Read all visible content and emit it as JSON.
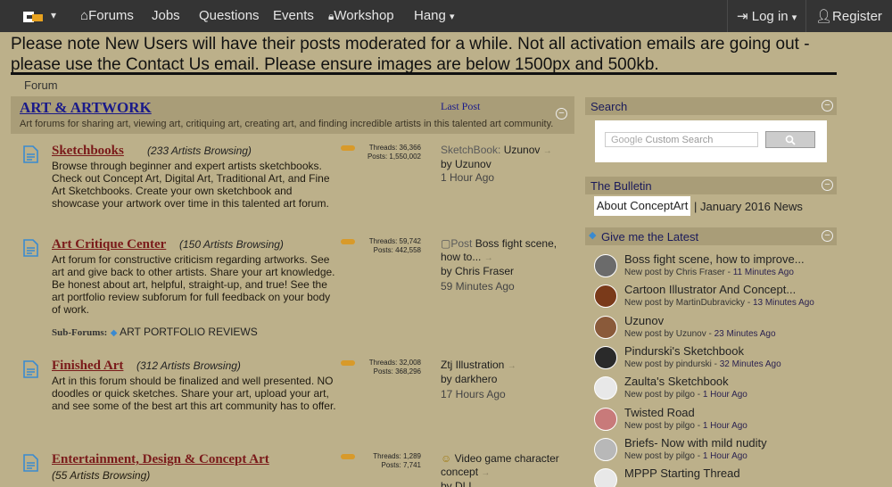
{
  "nav": {
    "items": [
      "Forums",
      "Jobs",
      "Questions",
      "Events",
      "Workshop",
      "Hang"
    ],
    "login": "Log in",
    "register": "Register"
  },
  "notice": "Please note New Users will have their posts moderated for a while. Not all activation emails are going out - please use the Contact Us email. Please ensure images are below 1500px and 500kb.",
  "breadcrumb": "Forum",
  "section": {
    "title": "ART & ARTWORK",
    "last_post_header": "Last Post",
    "description": "Art forums for sharing art, viewing art, critiquing art, creating art, and finding incredible artists in this talented art community."
  },
  "forums": [
    {
      "title": "Sketchbooks",
      "browsing": "(233 Artists Browsing)",
      "description": "Browse through beginner and expert artists sketchbooks. Check out Concept Art, Digital Art, Traditional Art, and Fine Art Sketchbooks. Create your own sketchbook and showcase your artwork over time in this talented art forum.",
      "threads": "Threads: 36,366",
      "posts": "Posts: 1,550,002",
      "last_prefix": "SketchBook: ",
      "last_title": "Uzunov",
      "last_by": "by ",
      "last_author": "Uzunov",
      "last_time": "1 Hour Ago"
    },
    {
      "title": "Art Critique Center",
      "browsing": "(150 Artists Browsing)",
      "description": "Art forum for constructive criticism regarding artworks. See art and give back to other artists. Share your art knowledge. Be honest about art, helpful, straight-up, and true! See the art portfolio review subforum for full feedback on your body of work.",
      "threads": "Threads: 59,742",
      "posts": "Posts: 442,558",
      "last_prefix": "Post ",
      "last_title": "Boss fight scene, how to...",
      "last_by": "by ",
      "last_author": "Chris Fraser",
      "last_time": "59 Minutes Ago",
      "subforums_label": "Sub-Forums:",
      "subforum": "ART PORTFOLIO REVIEWS"
    },
    {
      "title": "Finished Art",
      "browsing": "(312 Artists Browsing)",
      "description": "Art in this forum should be finalized and well presented. NO doodles or quick sketches. Share your art, upload your art, and see some of the best art this art community has to offer.",
      "threads": "Threads: 32,008",
      "posts": "Posts: 368,296",
      "last_prefix": "",
      "last_title": "Ztj Illustration",
      "last_by": "by ",
      "last_author": "darkhero",
      "last_time": "17 Hours Ago"
    },
    {
      "title": "Entertainment, Design & Concept Art",
      "browsing": "(55 Artists Browsing)",
      "description": "",
      "threads": "Threads: 1,289",
      "posts": "Posts: 7,741",
      "last_prefix": "",
      "last_title": "Video game character concept",
      "last_by": "by ",
      "last_author": "DLL",
      "last_time": ""
    }
  ],
  "sidebar": {
    "search_title": "Search",
    "search_placeholder": "Custom Search",
    "google_label": "Google",
    "bulletin_title": "The Bulletin",
    "about_link": "About ConceptArt",
    "bulletin_sep": "|",
    "january_link": "January 2016 News",
    "latest_title": "Give me the Latest",
    "latest": [
      {
        "title": "Boss fight scene, how to improve...",
        "meta": "New post by Chris Fraser - ",
        "time": "11 Minutes Ago"
      },
      {
        "title": "Cartoon Illustrator And Concept...",
        "meta": "New post by MartinDubravicky - ",
        "time": "13 Minutes Ago"
      },
      {
        "title": "Uzunov",
        "meta": "New post by Uzunov - ",
        "time": "23 Minutes Ago"
      },
      {
        "title": "Pindurski's Sketchbook",
        "meta": "New post by pindurski - ",
        "time": "32 Minutes Ago"
      },
      {
        "title": "Zaulta's Sketchbook",
        "meta": "New post by pilgo - ",
        "time": "1 Hour Ago"
      },
      {
        "title": "Twisted Road",
        "meta": "New post by pilgo - ",
        "time": "1 Hour Ago"
      },
      {
        "title": "Briefs- Now with mild nudity",
        "meta": "New post by pilgo - ",
        "time": "1 Hour Ago"
      },
      {
        "title": "MPPP Starting Thread",
        "meta": "",
        "time": ""
      }
    ]
  },
  "colors": {
    "nav_bg": "#343434",
    "page_bg": "#bcb08a",
    "header_bg": "#a99d78",
    "forum_title": "#7a1a1a",
    "tag": "#d89a2a"
  }
}
